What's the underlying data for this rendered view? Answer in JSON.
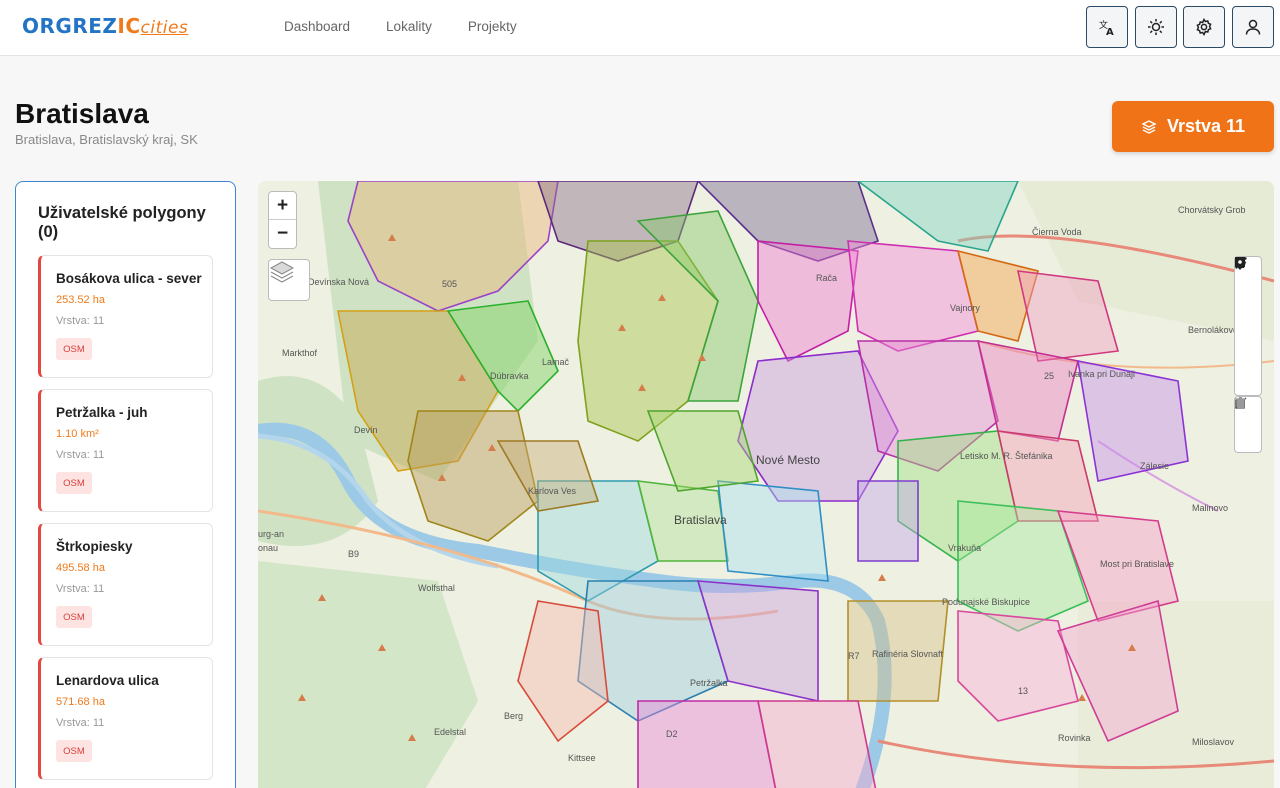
{
  "app": {
    "logo_part1": "ORGREZ",
    "logo_part2": "IC",
    "logo_part3": "cities",
    "accent": "#f07318",
    "brand_blue": "#2474c6"
  },
  "nav": [
    {
      "label": "Dashboard"
    },
    {
      "label": "Lokality"
    },
    {
      "label": "Projekty"
    }
  ],
  "toolbar_icons": [
    "translate-icon",
    "theme-sun-icon",
    "settings-gear-icon",
    "user-icon"
  ],
  "header": {
    "title": "Bratislava",
    "subtitle": "Bratislava, Bratislavský kraj, SK",
    "layer_button": "Vrstva 11"
  },
  "sidebar": {
    "title": "Uživatelské polygony (0)",
    "cards": [
      {
        "name": "Bosákova ulica - sever",
        "area": "253.52 ha",
        "layer": "Vrstva: 11",
        "badge": "OSM"
      },
      {
        "name": "Petržalka - juh",
        "area": "1.10 km²",
        "layer": "Vrstva: 11",
        "badge": "OSM"
      },
      {
        "name": "Štrkopiesky",
        "area": "495.58 ha",
        "layer": "Vrstva: 11",
        "badge": "OSM"
      },
      {
        "name": "Lenardova ulica",
        "area": "571.68 ha",
        "layer": "Vrstva: 11",
        "badge": "OSM"
      }
    ]
  },
  "map": {
    "zoom_in": "+",
    "zoom_out": "−",
    "draw_tools": [
      "polyline-icon",
      "polygon-icon",
      "rectangle-icon",
      "circle-icon",
      "marker-icon"
    ],
    "edit_tools": [
      "edit-icon",
      "delete-icon"
    ],
    "labels": {
      "bratislava": "Bratislava",
      "nove_mesto": "Nové Mesto",
      "karlova_ves": "Karlova Ves",
      "dubravka": "Dúbravka",
      "lamac": "Lamač",
      "devinska": "Devínska Nová",
      "devin": "Devín",
      "markthof": "Markthof",
      "wolfsthal": "Wolfsthal",
      "berg": "Berg",
      "edelstal": "Edelstal",
      "kittsee": "Kittsee",
      "vrakuna": "Vrakuňa",
      "podunajske": "Podunajské Biskupice",
      "rovinka": "Rovinka",
      "miloslavov": "Miloslavov",
      "most": "Most pri Bratislave",
      "zalesie": "Zálesie",
      "ivanka": "Ivanka pri Dunaji",
      "cierna_voda": "Čierna Voda",
      "chorvatsky": "Chorvátsky Grob",
      "bernolakovo": "Bernolákovo",
      "malinovo": "Malinovo",
      "letisko": "Letisko M. R. Štefánika",
      "rajka": "Rača",
      "vajnory": "Vajnory",
      "petrzalka": "Petržalka",
      "rafineria": "Rafinéria Slovnaft",
      "burg": "urg-an",
      "donau": "onau",
      "b9": "B9",
      "r7": "R7",
      "d2": "D2",
      "n505": "505",
      "n25": "25",
      "n13": "13"
    }
  }
}
